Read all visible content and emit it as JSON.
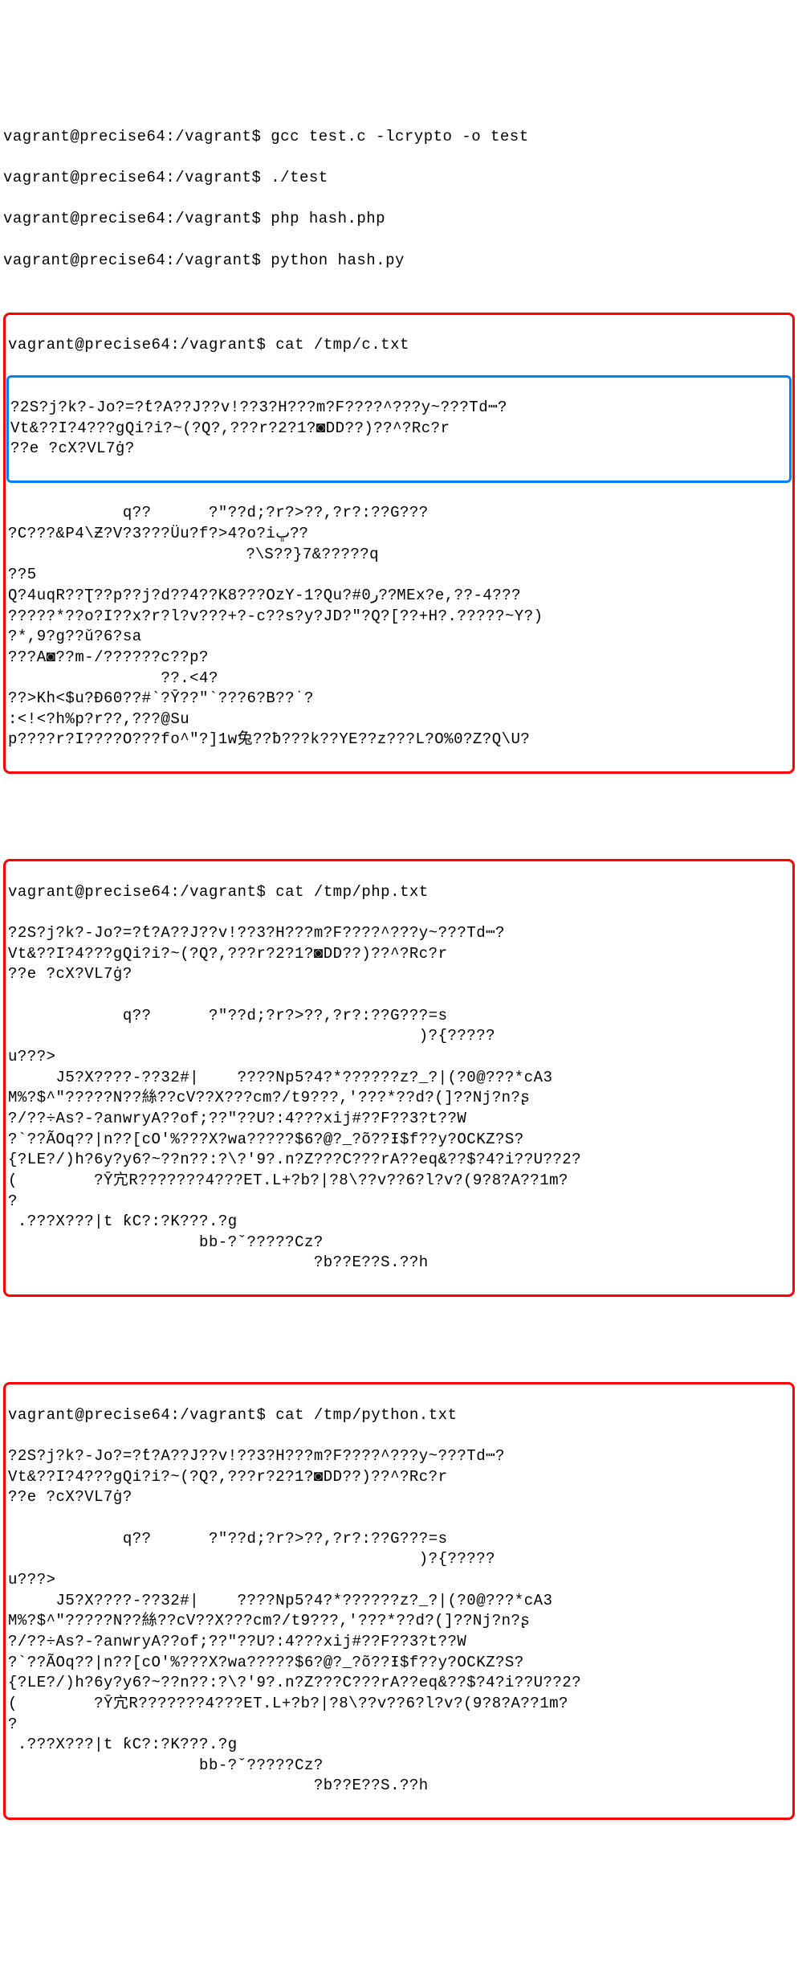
{
  "prompt": "vagrant@precise64:/vagrant$",
  "commands": {
    "gcc": "gcc test.c -lcrypto -o test",
    "run_test": "./test",
    "php": "php hash.php",
    "python": "python hash.py",
    "cat_c": "cat /tmp/c.txt",
    "cat_php": "cat /tmp/php.txt",
    "cat_python": "cat /tmp/python.txt"
  },
  "output_common_blue": "?2S?j?k?-Jo?=?ƭ?A??J??v!??3?H???m?F????^???y~???Td┉?\nVt&??I?4???gQi?i?~(?Q?,???r?2?1?◙DD??)??^?Rc?r\n??e ?cX?VL7ġ?",
  "output_c_rest": "            q??      ?\"??d;?r?>??,?r?:??G???\n?C???&P4\\Ƶ?V?3???Üu?f?>4?o?iڀ??\n                          ?\\S??}7&?????q\n??5\nQ?4uqR??Ʈ??p??j?d??4??K8???OzY-1?Qu?#0ر??MEx?e,??-4???\n?????*??o?I??x?r?l?v???+?-c??s?y?JD?\"?Q?[??+H?.?????~Y?)\n?*,9?g??ǔ?6?sa\n???A◙??m-/??????c??p?\n                ??.<4?\n??>Kh<$u?Ð60??#`?Ȳ??\"`???6?B??˙?\n:<!<?h%p?r??,???@Su\np????r?I????O???fo^\"?]1w兔??ƀ???k??YE??z???L?O%0?Z?Q\\U?",
  "output_php_rest": "            q??      ?\"??d;?r?>??,?r?:??G???=s\n                                           )?{?????\nu???>\n     J5?X????-??32#|    ????Np5?4?*??????z?_?|(?0@???*cA3\nM%?$^\"?????N??絲??cV??X???cm?/t9???,'???*??d?(]??Nj?n?ʂ\n?/??÷As?-?anwryA??of;??\"??U?:4???xij#??F??3?t??W\n?`??ÃOq??|n??[cO'%???X?wa?????$6?@?_?õ??Ɨ$f??y?OCKZ?S?\n{?LE?/)h?6y?y6?~??n??:?\\?'9?.n?Z???C???rA??eq&??$?4?i??U??2?\n(        ?Ȳ宂R???????4???ET.L+?b?|?8\\??v??6?l?v?(9?8?A??1m?\n?\n .???X???|t ƙC?:?K???.?g\n                    bb-?ˇ?????Cz?\n                                ?b??E??S.??h",
  "output_python_rest": "            q??      ?\"??d;?r?>??,?r?:??G???=s\n                                           )?{?????\nu???>\n     J5?X????-??32#|    ????Np5?4?*??????z?_?|(?0@???*cA3\nM%?$^\"?????N??絲??cV??X???cm?/t9???,'???*??d?(]??Nj?n?ʂ\n?/??÷As?-?anwryA??of;??\"??U?:4???xij#??F??3?t??W\n?`??ÃOq??|n??[cO'%???X?wa?????$6?@?_?õ??Ɨ$f??y?OCKZ?S?\n{?LE?/)h?6y?y6?~??n??:?\\?'9?.n?Z???C???rA??eq&??$?4?i??U??2?\n(        ?Ȳ宂R???????4???ET.L+?b?|?8\\??v??6?l?v?(9?8?A??1m?\n?\n .???X???|t ƙC?:?K???.?g\n                    bb-?ˇ?????Cz?\n                                ?b??E??S.??h"
}
